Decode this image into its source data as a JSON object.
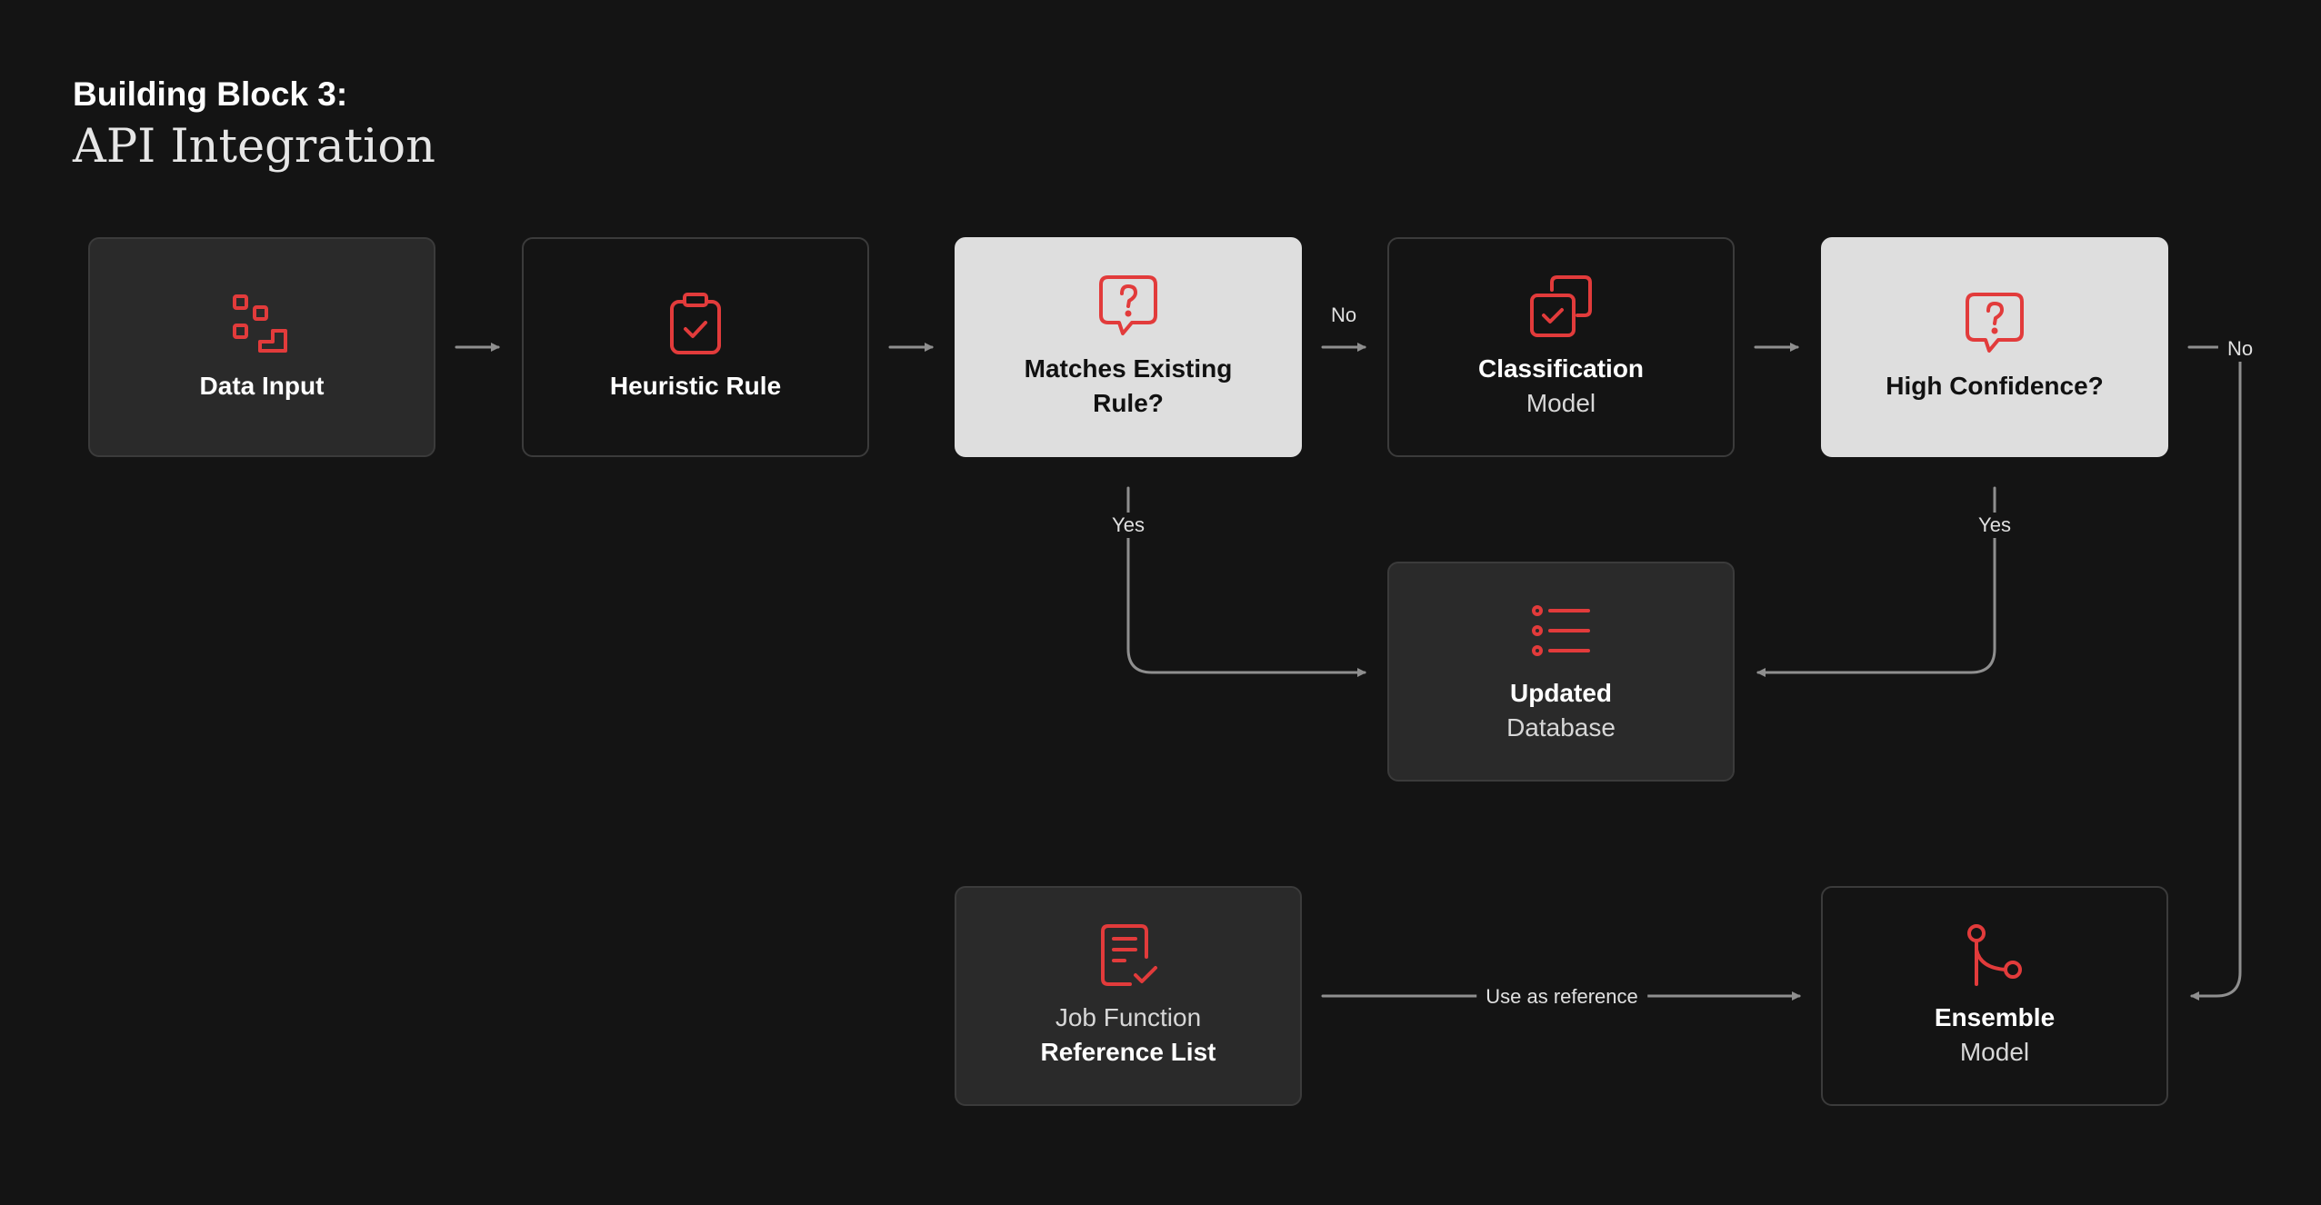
{
  "heading": {
    "kicker": "Building Block 3:",
    "title": "API Integration"
  },
  "colors": {
    "background": "#141414",
    "accent": "#e23b3b",
    "edge": "#8f8f8f",
    "light_node": "#dedede",
    "dark_node": "#2a2a2a"
  },
  "nodes": {
    "data_input": {
      "icon": "stairs-squares-icon",
      "lines": [
        "Data Input"
      ]
    },
    "heuristic_rule": {
      "icon": "clipboard-check-icon",
      "lines": [
        "Heuristic Rule"
      ]
    },
    "matches_rule": {
      "icon": "question-bubble-icon",
      "lines": [
        "Matches Existing",
        "Rule?"
      ]
    },
    "classification": {
      "icon": "stacked-check-icon",
      "title": "Classification",
      "subtitle": "Model"
    },
    "high_confidence": {
      "icon": "question-bubble-icon",
      "lines": [
        "High Confidence?"
      ]
    },
    "updated_db": {
      "icon": "list-icon",
      "title": "Updated",
      "subtitle": "Database"
    },
    "reference_list": {
      "icon": "document-check-icon",
      "subtitle": "Job Function",
      "title": "Reference List"
    },
    "ensemble": {
      "icon": "branch-icon",
      "title": "Ensemble",
      "subtitle": "Model"
    }
  },
  "edge_labels": {
    "no_1": "No",
    "no_2": "No",
    "yes_1": "Yes",
    "yes_2": "Yes",
    "reference": "Use as reference"
  }
}
